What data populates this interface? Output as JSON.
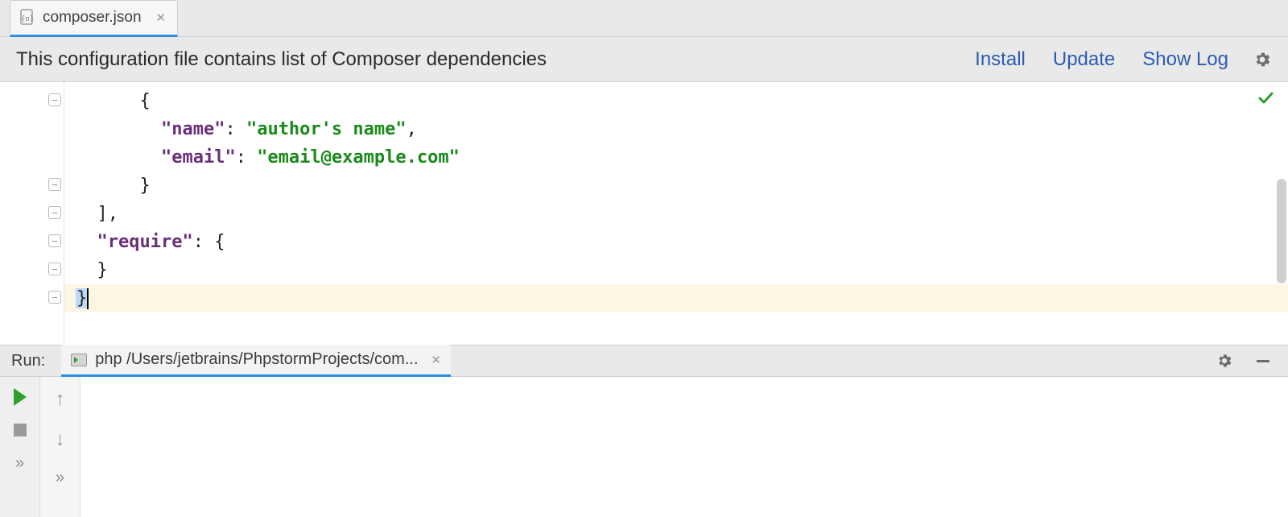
{
  "tab": {
    "filename": "composer.json"
  },
  "info": {
    "message": "This configuration file contains list of Composer dependencies",
    "links": {
      "install": "Install",
      "update": "Update",
      "show_log": "Show Log"
    }
  },
  "code": {
    "lines": [
      {
        "indent": 3,
        "tokens": [
          {
            "t": "p",
            "v": "{"
          }
        ]
      },
      {
        "indent": 4,
        "tokens": [
          {
            "t": "k",
            "v": "\"name\""
          },
          {
            "t": "p",
            "v": ": "
          },
          {
            "t": "s",
            "v": "\"author's name\""
          },
          {
            "t": "p",
            "v": ","
          }
        ]
      },
      {
        "indent": 4,
        "tokens": [
          {
            "t": "k",
            "v": "\"email\""
          },
          {
            "t": "p",
            "v": ": "
          },
          {
            "t": "s",
            "v": "\"email@example.com\""
          }
        ]
      },
      {
        "indent": 3,
        "tokens": [
          {
            "t": "p",
            "v": "}"
          }
        ]
      },
      {
        "indent": 1,
        "tokens": [
          {
            "t": "p",
            "v": "],"
          }
        ]
      },
      {
        "indent": 1,
        "tokens": [
          {
            "t": "k",
            "v": "\"require\""
          },
          {
            "t": "p",
            "v": ": {"
          }
        ]
      },
      {
        "indent": 1,
        "tokens": [
          {
            "t": "p",
            "v": "}"
          }
        ]
      },
      {
        "indent": 0,
        "tokens": [
          {
            "t": "p",
            "v": "}"
          }
        ],
        "highlight": true,
        "caret": true
      }
    ],
    "fold_rows": [
      0,
      3,
      4,
      5,
      6,
      7
    ]
  },
  "run": {
    "label": "Run:",
    "tab_title": "php /Users/jetbrains/PhpstormProjects/com..."
  }
}
